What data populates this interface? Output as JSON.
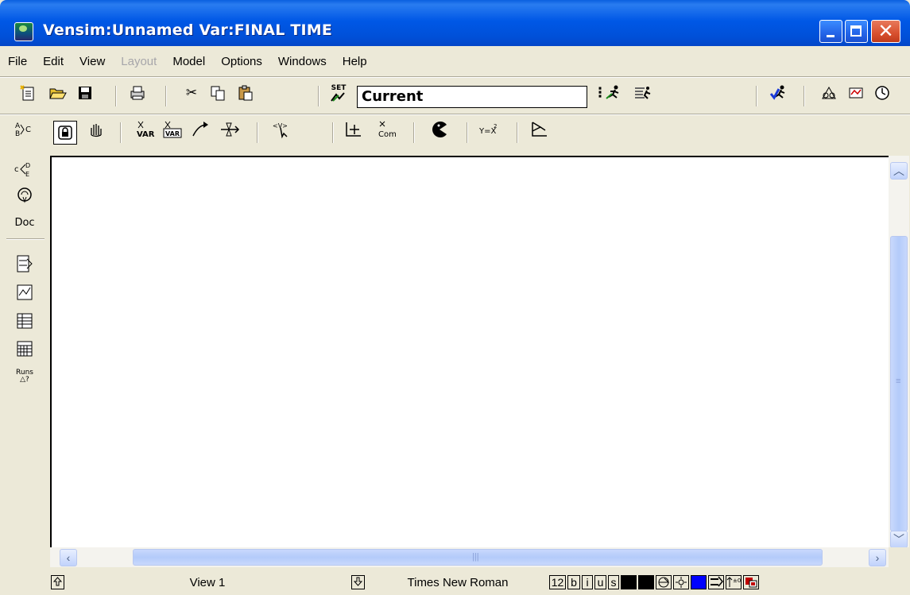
{
  "window": {
    "title": "Vensim:Unnamed Var:FINAL TIME",
    "app_icon": "vensim-app-icon",
    "controls": {
      "minimize": "minimize-icon",
      "maximize": "maximize-icon",
      "close": "close-icon"
    }
  },
  "menu": [
    "File",
    "Edit",
    "View",
    "Layout",
    "Model",
    "Options",
    "Windows",
    "Help"
  ],
  "menu_disabled": [
    "Layout"
  ],
  "toolbar": {
    "run_name": "Current",
    "set_label": "SET"
  },
  "sketch_toolbar": {
    "var_label": "VAR",
    "com_label": "Com"
  },
  "left_toolbar": {
    "doc_label": "Doc",
    "runs_label": "Runs",
    "runs_sub": "△?"
  },
  "status": {
    "view": "View 1",
    "font": "Times New Roman",
    "size": "12",
    "bold": "b",
    "italic": "i",
    "underline": "u",
    "strike": "s"
  },
  "colors": {
    "titlebar": "#0058e6",
    "chrome": "#ece9d8",
    "canvas": "#ffffff",
    "status_blue": "#0000ff",
    "status_black": "#000000",
    "scroll_thumb": "#c1d3fb"
  }
}
